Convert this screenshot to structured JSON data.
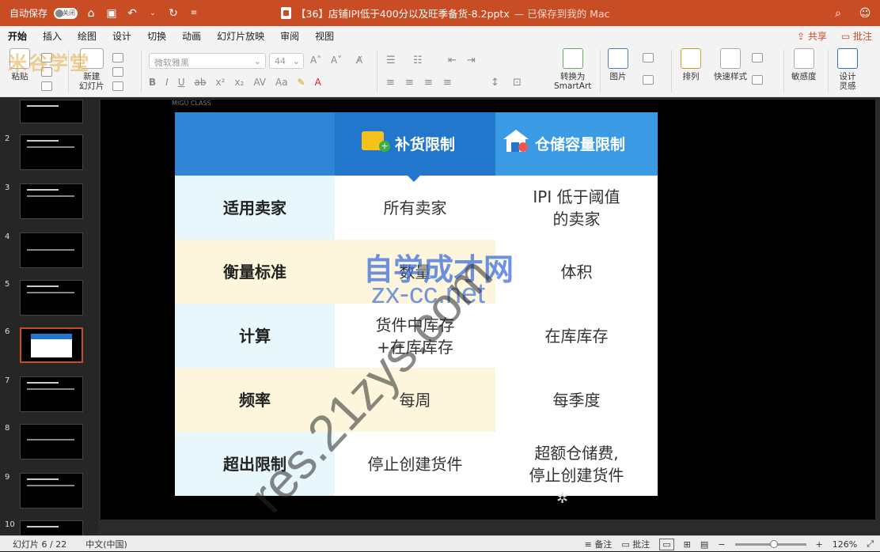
{
  "titlebar": {
    "autosave_label": "自动保存",
    "autosave_state": "关闭",
    "file_title": "【36】店铺IPI低于400分以及旺季备货-8.2pptx",
    "saved_status": "— 已保存到我的 Mac"
  },
  "menu": {
    "tabs": [
      "开始",
      "插入",
      "绘图",
      "设计",
      "切换",
      "动画",
      "幻灯片放映",
      "审阅",
      "视图"
    ],
    "share_label": "共享",
    "comments_label": "批注"
  },
  "ribbon": {
    "paste_label": "粘贴",
    "new_slide_label": "新建\n幻灯片",
    "font_name_placeholder": "微软雅黑",
    "font_size_value": "44",
    "convert_smartart_label": "转换为\nSmartArt",
    "picture_label": "图片",
    "arrange_label": "排列",
    "quick_styles_label": "快速样式",
    "sensitivity_label": "敏感度",
    "designer_label": "设计\n灵感",
    "logo_watermark": "米谷学堂"
  },
  "sidebar": {
    "slides": [
      {
        "num": "2"
      },
      {
        "num": "3"
      },
      {
        "num": "4"
      },
      {
        "num": "5"
      },
      {
        "num": "6"
      },
      {
        "num": "7"
      },
      {
        "num": "8"
      },
      {
        "num": "9"
      },
      {
        "num": "10"
      }
    ],
    "active_index": 6
  },
  "slide": {
    "brand_text": "MIGU CLASS",
    "headers": [
      "",
      "补货限制",
      "仓储容量限制"
    ],
    "rows": [
      {
        "label": "适用卖家",
        "col1": "所有卖家",
        "col2": "IPI 低于阈值\n的卖家"
      },
      {
        "label": "衡量标准",
        "col1": "数量",
        "col2": "体积"
      },
      {
        "label": "计算",
        "col1": "货件中库存\n+在库库存",
        "col2": "在库库存"
      },
      {
        "label": "频率",
        "col1": "每周",
        "col2": "每季度"
      },
      {
        "label": "超出限制",
        "col1": "停止创建货件",
        "col2": "超额仓储费,\n停止创建货件"
      }
    ],
    "watermarks": {
      "site1": "自学成才网",
      "site2": "zx-cc.net",
      "diagonal": "res.21zys.com"
    }
  },
  "statusbar": {
    "slide_count": "幻灯片 6 / 22",
    "language": "中文(中国)",
    "notes_label": "备注",
    "comments_label": "批注",
    "zoom_level": "126%"
  },
  "colors": {
    "accent": "#c94d24",
    "header_blue": "#2277cc",
    "row_light_blue": "#e8f7fb",
    "row_light_yellow": "#fdf6dc"
  }
}
